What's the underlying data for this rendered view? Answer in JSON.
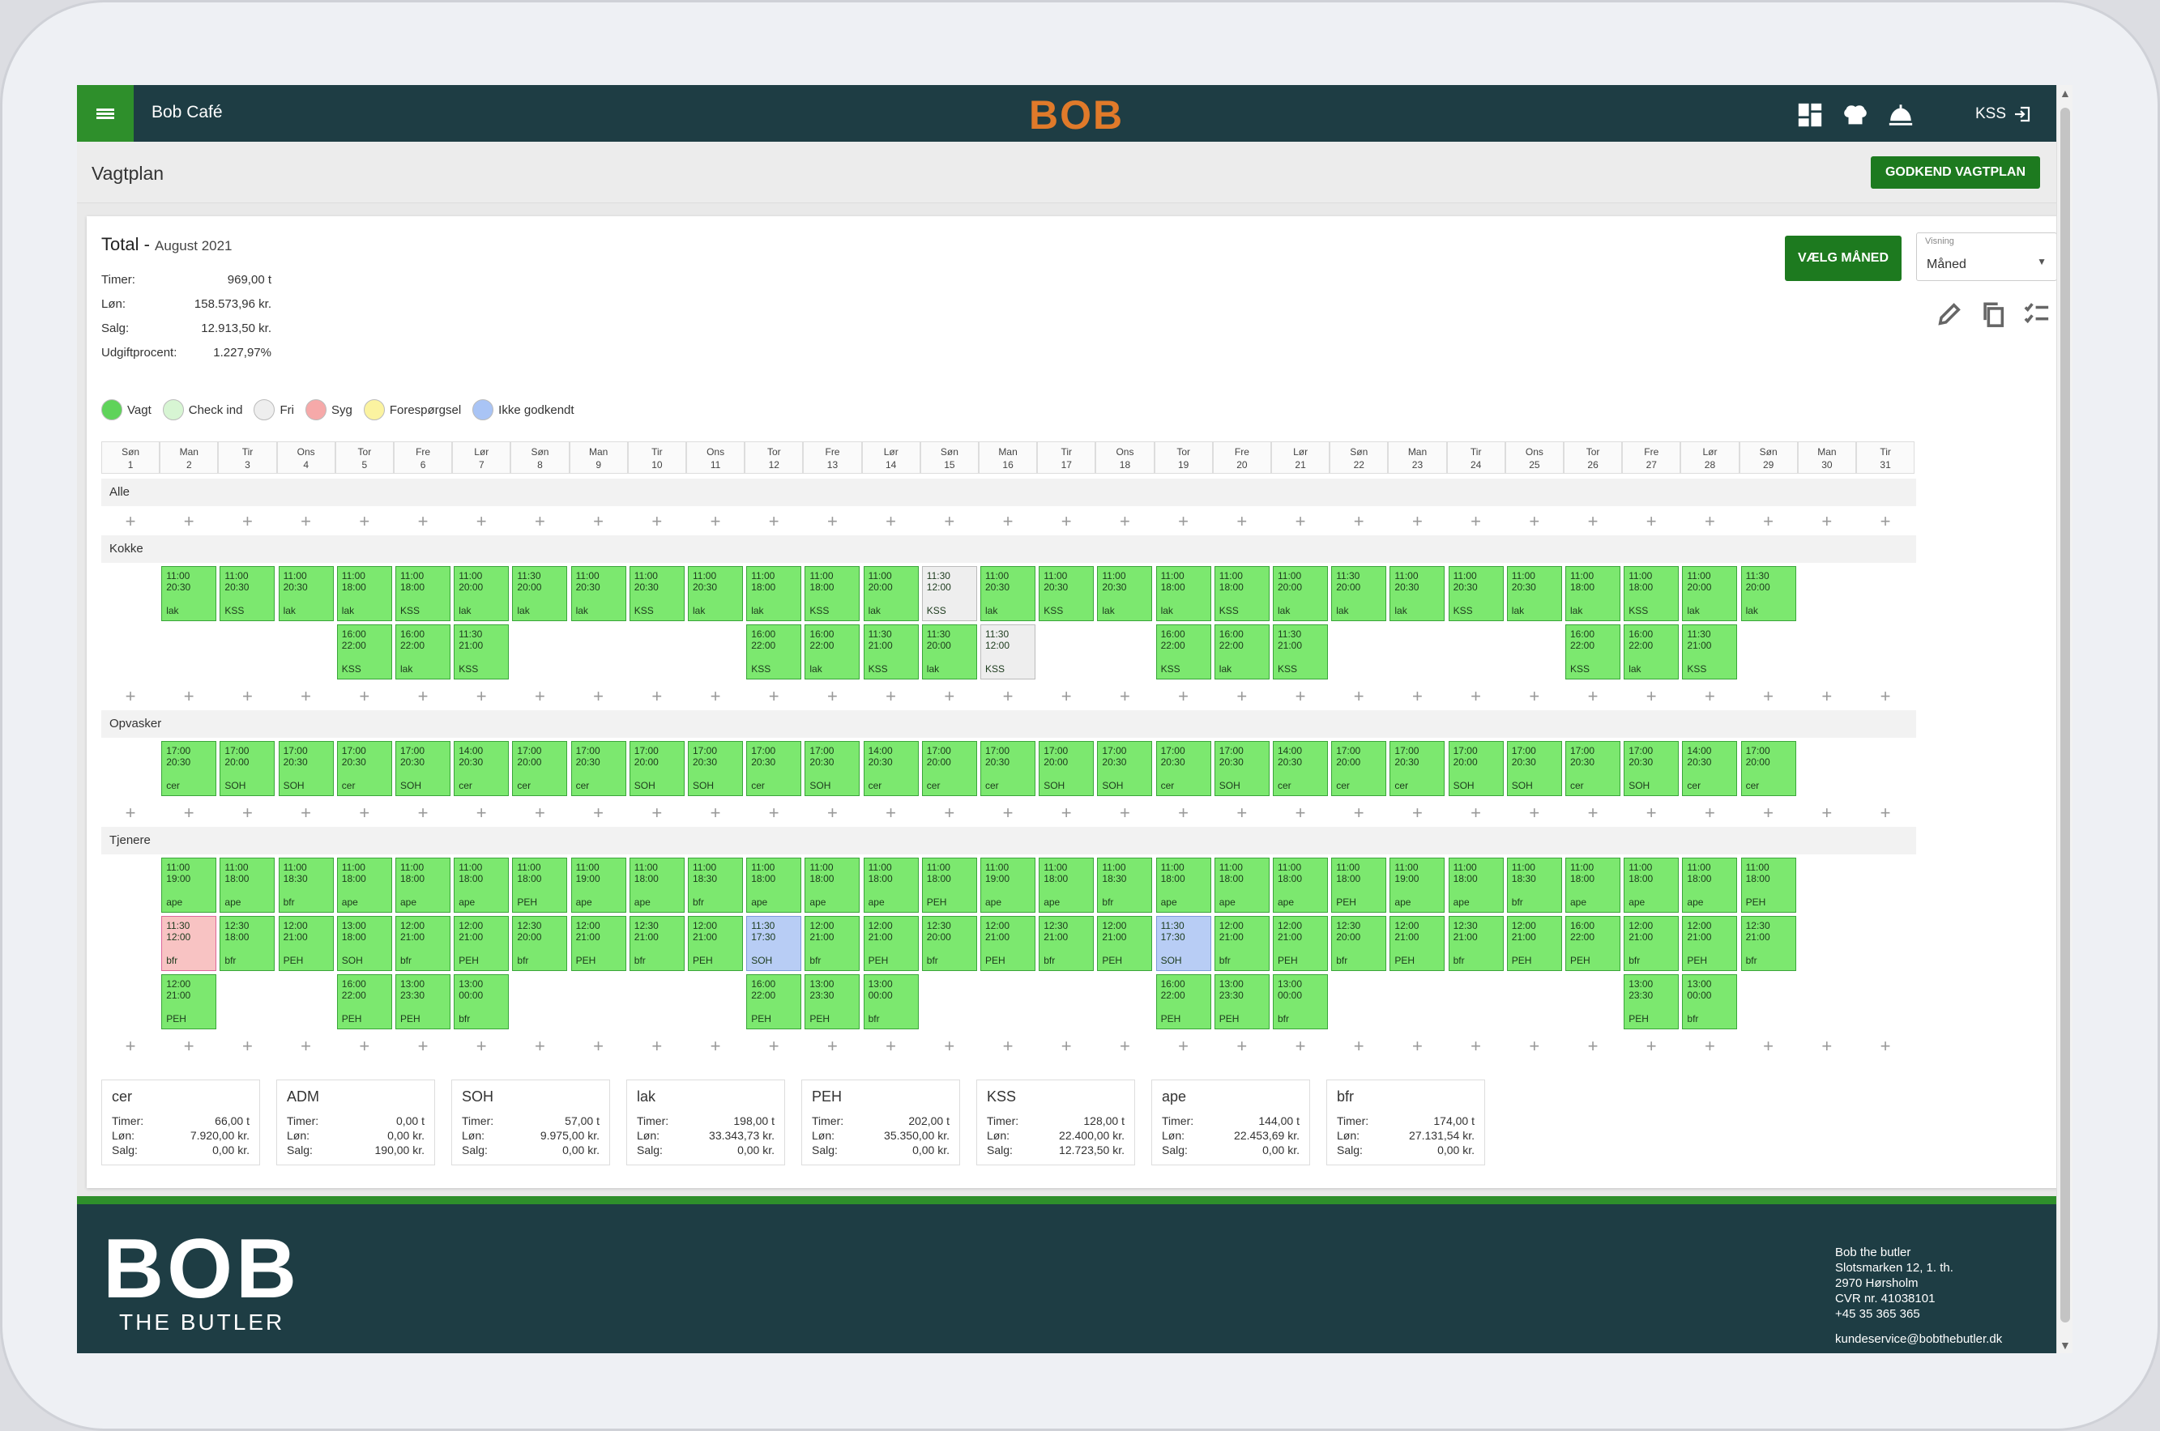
{
  "app": {
    "title": "Bob Café",
    "logo": "BOB",
    "user": "KSS"
  },
  "page": {
    "title": "Vagtplan",
    "approve_label": "GODKEND VAGTPLAN"
  },
  "total": {
    "title": "Total",
    "period": "August 2021"
  },
  "stats": [
    {
      "label": "Timer:",
      "value": "969,00 t"
    },
    {
      "label": "Løn:",
      "value": "158.573,96 kr."
    },
    {
      "label": "Salg:",
      "value": "12.913,50 kr."
    },
    {
      "label": "Udgiftprocent:",
      "value": "1.227,97%"
    }
  ],
  "controls": {
    "choose_month": "VÆLG MÅNED",
    "view_label": "Visning",
    "view_value": "Måned"
  },
  "legend": [
    {
      "label": "Vagt",
      "color": "#5fd35a"
    },
    {
      "label": "Check ind",
      "color": "#d7f5d3"
    },
    {
      "label": "Fri",
      "color": "#eeeeee"
    },
    {
      "label": "Syg",
      "color": "#f6a9a9"
    },
    {
      "label": "Forespørgsel",
      "color": "#fbf3a0"
    },
    {
      "label": "Ikke godkendt",
      "color": "#a9c4f5"
    }
  ],
  "days": [
    [
      "Søn",
      "1"
    ],
    [
      "Man",
      "2"
    ],
    [
      "Tir",
      "3"
    ],
    [
      "Ons",
      "4"
    ],
    [
      "Tor",
      "5"
    ],
    [
      "Fre",
      "6"
    ],
    [
      "Lør",
      "7"
    ],
    [
      "Søn",
      "8"
    ],
    [
      "Man",
      "9"
    ],
    [
      "Tir",
      "10"
    ],
    [
      "Ons",
      "11"
    ],
    [
      "Tor",
      "12"
    ],
    [
      "Fre",
      "13"
    ],
    [
      "Lør",
      "14"
    ],
    [
      "Søn",
      "15"
    ],
    [
      "Man",
      "16"
    ],
    [
      "Tir",
      "17"
    ],
    [
      "Ons",
      "18"
    ],
    [
      "Tor",
      "19"
    ],
    [
      "Fre",
      "20"
    ],
    [
      "Lør",
      "21"
    ],
    [
      "Søn",
      "22"
    ],
    [
      "Man",
      "23"
    ],
    [
      "Tir",
      "24"
    ],
    [
      "Ons",
      "25"
    ],
    [
      "Tor",
      "26"
    ],
    [
      "Fre",
      "27"
    ],
    [
      "Lør",
      "28"
    ],
    [
      "Søn",
      "29"
    ],
    [
      "Man",
      "30"
    ],
    [
      "Tir",
      "31"
    ]
  ],
  "sections": [
    "Alle",
    "Kokke",
    "Opvasker",
    "Tjenere"
  ],
  "kokke_row1": [
    [
      2,
      "11:00",
      "20:30",
      "lak",
      "v"
    ],
    [
      3,
      "11:00",
      "20:30",
      "KSS",
      "v"
    ],
    [
      4,
      "11:00",
      "20:30",
      "lak",
      "v"
    ],
    [
      5,
      "11:00",
      "18:00",
      "lak",
      "v"
    ],
    [
      6,
      "11:00",
      "18:00",
      "KSS",
      "v"
    ],
    [
      7,
      "11:00",
      "20:00",
      "lak",
      "v"
    ],
    [
      8,
      "11:30",
      "20:00",
      "lak",
      "v"
    ],
    [
      9,
      "11:00",
      "20:30",
      "lak",
      "v"
    ],
    [
      10,
      "11:00",
      "20:30",
      "KSS",
      "v"
    ],
    [
      11,
      "11:00",
      "20:30",
      "lak",
      "v"
    ],
    [
      12,
      "11:00",
      "18:00",
      "lak",
      "v"
    ],
    [
      13,
      "11:00",
      "18:00",
      "KSS",
      "v"
    ],
    [
      14,
      "11:00",
      "20:00",
      "lak",
      "v"
    ],
    [
      15,
      "11:30",
      "12:00",
      "KSS",
      "f"
    ],
    [
      16,
      "11:00",
      "20:30",
      "lak",
      "v"
    ],
    [
      17,
      "11:00",
      "20:30",
      "KSS",
      "v"
    ],
    [
      18,
      "11:00",
      "20:30",
      "lak",
      "v"
    ],
    [
      19,
      "11:00",
      "18:00",
      "lak",
      "v"
    ],
    [
      20,
      "11:00",
      "18:00",
      "KSS",
      "v"
    ],
    [
      21,
      "11:00",
      "20:00",
      "lak",
      "v"
    ],
    [
      22,
      "11:30",
      "20:00",
      "lak",
      "v"
    ],
    [
      23,
      "11:00",
      "20:30",
      "lak",
      "v"
    ],
    [
      24,
      "11:00",
      "20:30",
      "KSS",
      "v"
    ],
    [
      25,
      "11:00",
      "20:30",
      "lak",
      "v"
    ],
    [
      26,
      "11:00",
      "18:00",
      "lak",
      "v"
    ],
    [
      27,
      "11:00",
      "18:00",
      "KSS",
      "v"
    ],
    [
      28,
      "11:00",
      "20:00",
      "lak",
      "v"
    ],
    [
      29,
      "11:30",
      "20:00",
      "lak",
      "v"
    ]
  ],
  "kokke_row2": [
    [
      5,
      "16:00",
      "22:00",
      "KSS",
      "v"
    ],
    [
      6,
      "16:00",
      "22:00",
      "lak",
      "v"
    ],
    [
      7,
      "11:30",
      "21:00",
      "KSS",
      "v"
    ],
    [
      12,
      "16:00",
      "22:00",
      "KSS",
      "v"
    ],
    [
      13,
      "16:00",
      "22:00",
      "lak",
      "v"
    ],
    [
      14,
      "11:30",
      "21:00",
      "KSS",
      "v"
    ],
    [
      15,
      "11:30",
      "20:00",
      "lak",
      "v"
    ],
    [
      16,
      "11:30",
      "12:00",
      "KSS",
      "f"
    ],
    [
      19,
      "16:00",
      "22:00",
      "KSS",
      "v"
    ],
    [
      20,
      "16:00",
      "22:00",
      "lak",
      "v"
    ],
    [
      21,
      "11:30",
      "21:00",
      "KSS",
      "v"
    ],
    [
      26,
      "16:00",
      "22:00",
      "KSS",
      "v"
    ],
    [
      27,
      "16:00",
      "22:00",
      "lak",
      "v"
    ],
    [
      28,
      "11:30",
      "21:00",
      "KSS",
      "v"
    ]
  ],
  "opvasker_row1": [
    [
      2,
      "17:00",
      "20:30",
      "cer",
      "v"
    ],
    [
      3,
      "17:00",
      "20:00",
      "SOH",
      "v"
    ],
    [
      4,
      "17:00",
      "20:30",
      "SOH",
      "v"
    ],
    [
      5,
      "17:00",
      "20:30",
      "cer",
      "v"
    ],
    [
      6,
      "17:00",
      "20:30",
      "SOH",
      "v"
    ],
    [
      7,
      "14:00",
      "20:30",
      "cer",
      "v"
    ],
    [
      8,
      "17:00",
      "20:00",
      "cer",
      "v"
    ],
    [
      9,
      "17:00",
      "20:30",
      "cer",
      "v"
    ],
    [
      10,
      "17:00",
      "20:00",
      "SOH",
      "v"
    ],
    [
      11,
      "17:00",
      "20:30",
      "SOH",
      "v"
    ],
    [
      12,
      "17:00",
      "20:30",
      "cer",
      "v"
    ],
    [
      13,
      "17:00",
      "20:30",
      "SOH",
      "v"
    ],
    [
      14,
      "14:00",
      "20:30",
      "cer",
      "v"
    ],
    [
      15,
      "17:00",
      "20:00",
      "cer",
      "v"
    ],
    [
      16,
      "17:00",
      "20:30",
      "cer",
      "v"
    ],
    [
      17,
      "17:00",
      "20:00",
      "SOH",
      "v"
    ],
    [
      18,
      "17:00",
      "20:30",
      "SOH",
      "v"
    ],
    [
      19,
      "17:00",
      "20:30",
      "cer",
      "v"
    ],
    [
      20,
      "17:00",
      "20:30",
      "SOH",
      "v"
    ],
    [
      21,
      "14:00",
      "20:30",
      "cer",
      "v"
    ],
    [
      22,
      "17:00",
      "20:00",
      "cer",
      "v"
    ],
    [
      23,
      "17:00",
      "20:30",
      "cer",
      "v"
    ],
    [
      24,
      "17:00",
      "20:00",
      "SOH",
      "v"
    ],
    [
      25,
      "17:00",
      "20:30",
      "SOH",
      "v"
    ],
    [
      26,
      "17:00",
      "20:30",
      "cer",
      "v"
    ],
    [
      27,
      "17:00",
      "20:30",
      "SOH",
      "v"
    ],
    [
      28,
      "14:00",
      "20:30",
      "cer",
      "v"
    ],
    [
      29,
      "17:00",
      "20:00",
      "cer",
      "v"
    ]
  ],
  "tjenere_row1": [
    [
      2,
      "11:00",
      "19:00",
      "ape",
      "v"
    ],
    [
      3,
      "11:00",
      "18:00",
      "ape",
      "v"
    ],
    [
      4,
      "11:00",
      "18:30",
      "bfr",
      "v"
    ],
    [
      5,
      "11:00",
      "18:00",
      "ape",
      "v"
    ],
    [
      6,
      "11:00",
      "18:00",
      "ape",
      "v"
    ],
    [
      7,
      "11:00",
      "18:00",
      "ape",
      "v"
    ],
    [
      8,
      "11:00",
      "18:00",
      "PEH",
      "v"
    ],
    [
      9,
      "11:00",
      "19:00",
      "ape",
      "v"
    ],
    [
      10,
      "11:00",
      "18:00",
      "ape",
      "v"
    ],
    [
      11,
      "11:00",
      "18:30",
      "bfr",
      "v"
    ],
    [
      12,
      "11:00",
      "18:00",
      "ape",
      "v"
    ],
    [
      13,
      "11:00",
      "18:00",
      "ape",
      "v"
    ],
    [
      14,
      "11:00",
      "18:00",
      "ape",
      "v"
    ],
    [
      15,
      "11:00",
      "18:00",
      "PEH",
      "v"
    ],
    [
      16,
      "11:00",
      "19:00",
      "ape",
      "v"
    ],
    [
      17,
      "11:00",
      "18:00",
      "ape",
      "v"
    ],
    [
      18,
      "11:00",
      "18:30",
      "bfr",
      "v"
    ],
    [
      19,
      "11:00",
      "18:00",
      "ape",
      "v"
    ],
    [
      20,
      "11:00",
      "18:00",
      "ape",
      "v"
    ],
    [
      21,
      "11:00",
      "18:00",
      "ape",
      "v"
    ],
    [
      22,
      "11:00",
      "18:00",
      "PEH",
      "v"
    ],
    [
      23,
      "11:00",
      "19:00",
      "ape",
      "v"
    ],
    [
      24,
      "11:00",
      "18:00",
      "ape",
      "v"
    ],
    [
      25,
      "11:00",
      "18:30",
      "bfr",
      "v"
    ],
    [
      26,
      "11:00",
      "18:00",
      "ape",
      "v"
    ],
    [
      27,
      "11:00",
      "18:00",
      "ape",
      "v"
    ],
    [
      28,
      "11:00",
      "18:00",
      "ape",
      "v"
    ],
    [
      29,
      "11:00",
      "18:00",
      "PEH",
      "v"
    ]
  ],
  "tjenere_row2": [
    [
      2,
      "11:30",
      "12:00",
      "bfr",
      "s"
    ],
    [
      3,
      "12:30",
      "18:00",
      "bfr",
      "v"
    ],
    [
      4,
      "12:00",
      "21:00",
      "PEH",
      "v"
    ],
    [
      5,
      "13:00",
      "18:00",
      "SOH",
      "v"
    ],
    [
      6,
      "12:00",
      "21:00",
      "bfr",
      "v"
    ],
    [
      7,
      "12:00",
      "21:00",
      "PEH",
      "v"
    ],
    [
      8,
      "12:30",
      "20:00",
      "bfr",
      "v"
    ],
    [
      9,
      "12:00",
      "21:00",
      "PEH",
      "v"
    ],
    [
      10,
      "12:30",
      "21:00",
      "bfr",
      "v"
    ],
    [
      11,
      "12:00",
      "21:00",
      "PEH",
      "v"
    ],
    [
      12,
      "11:30",
      "17:30",
      "SOH",
      "b"
    ],
    [
      13,
      "12:00",
      "21:00",
      "bfr",
      "v"
    ],
    [
      14,
      "12:00",
      "21:00",
      "PEH",
      "v"
    ],
    [
      15,
      "12:30",
      "20:00",
      "bfr",
      "v"
    ],
    [
      16,
      "12:00",
      "21:00",
      "PEH",
      "v"
    ],
    [
      17,
      "12:30",
      "21:00",
      "bfr",
      "v"
    ],
    [
      18,
      "12:00",
      "21:00",
      "PEH",
      "v"
    ],
    [
      19,
      "11:30",
      "17:30",
      "SOH",
      "b"
    ],
    [
      20,
      "12:00",
      "21:00",
      "bfr",
      "v"
    ],
    [
      21,
      "12:00",
      "21:00",
      "PEH",
      "v"
    ],
    [
      22,
      "12:30",
      "20:00",
      "bfr",
      "v"
    ],
    [
      23,
      "12:00",
      "21:00",
      "PEH",
      "v"
    ],
    [
      24,
      "12:30",
      "21:00",
      "bfr",
      "v"
    ],
    [
      25,
      "12:00",
      "21:00",
      "PEH",
      "v"
    ],
    [
      26,
      "16:00",
      "22:00",
      "PEH",
      "v"
    ],
    [
      27,
      "12:00",
      "21:00",
      "bfr",
      "v"
    ],
    [
      28,
      "12:00",
      "21:00",
      "PEH",
      "v"
    ],
    [
      29,
      "12:30",
      "21:00",
      "bfr",
      "v"
    ]
  ],
  "tjenere_row3": [
    [
      2,
      "12:00",
      "21:00",
      "PEH",
      "v"
    ],
    [
      5,
      "16:00",
      "22:00",
      "PEH",
      "v"
    ],
    [
      6,
      "13:00",
      "23:30",
      "PEH",
      "v"
    ],
    [
      7,
      "13:00",
      "00:00",
      "bfr",
      "v"
    ],
    [
      12,
      "16:00",
      "22:00",
      "PEH",
      "v"
    ],
    [
      13,
      "13:00",
      "23:30",
      "PEH",
      "v"
    ],
    [
      14,
      "13:00",
      "00:00",
      "bfr",
      "v"
    ],
    [
      19,
      "16:00",
      "22:00",
      "PEH",
      "v"
    ],
    [
      20,
      "13:00",
      "23:30",
      "PEH",
      "v"
    ],
    [
      21,
      "13:00",
      "00:00",
      "bfr",
      "v"
    ],
    [
      27,
      "13:00",
      "23:30",
      "PEH",
      "v"
    ],
    [
      28,
      "13:00",
      "00:00",
      "bfr",
      "v"
    ]
  ],
  "summaries": [
    {
      "name": "cer",
      "timer": "66,00 t",
      "lon": "7.920,00 kr.",
      "salg": "0,00 kr."
    },
    {
      "name": "ADM",
      "timer": "0,00 t",
      "lon": "0,00 kr.",
      "salg": "190,00 kr."
    },
    {
      "name": "SOH",
      "timer": "57,00 t",
      "lon": "9.975,00 kr.",
      "salg": "0,00 kr."
    },
    {
      "name": "lak",
      "timer": "198,00 t",
      "lon": "33.343,73 kr.",
      "salg": "0,00 kr."
    },
    {
      "name": "PEH",
      "timer": "202,00 t",
      "lon": "35.350,00 kr.",
      "salg": "0,00 kr."
    },
    {
      "name": "KSS",
      "timer": "128,00 t",
      "lon": "22.400,00 kr.",
      "salg": "12.723,50 kr."
    },
    {
      "name": "ape",
      "timer": "144,00 t",
      "lon": "22.453,69 kr.",
      "salg": "0,00 kr."
    },
    {
      "name": "bfr",
      "timer": "174,00 t",
      "lon": "27.131,54 kr.",
      "salg": "0,00 kr."
    }
  ],
  "summary_labels": {
    "timer": "Timer:",
    "lon": "Løn:",
    "salg": "Salg:"
  },
  "footer": {
    "logo_big": "BOB",
    "logo_small": "THE BUTLER",
    "company": "Bob the butler",
    "address1": "Slotsmarken 12, 1. th.",
    "address2": "2970 Hørsholm",
    "cvr": "CVR nr. 41038101",
    "phone": "+45 35 365 365",
    "email": "kundeservice@bobthebutler.dk"
  }
}
